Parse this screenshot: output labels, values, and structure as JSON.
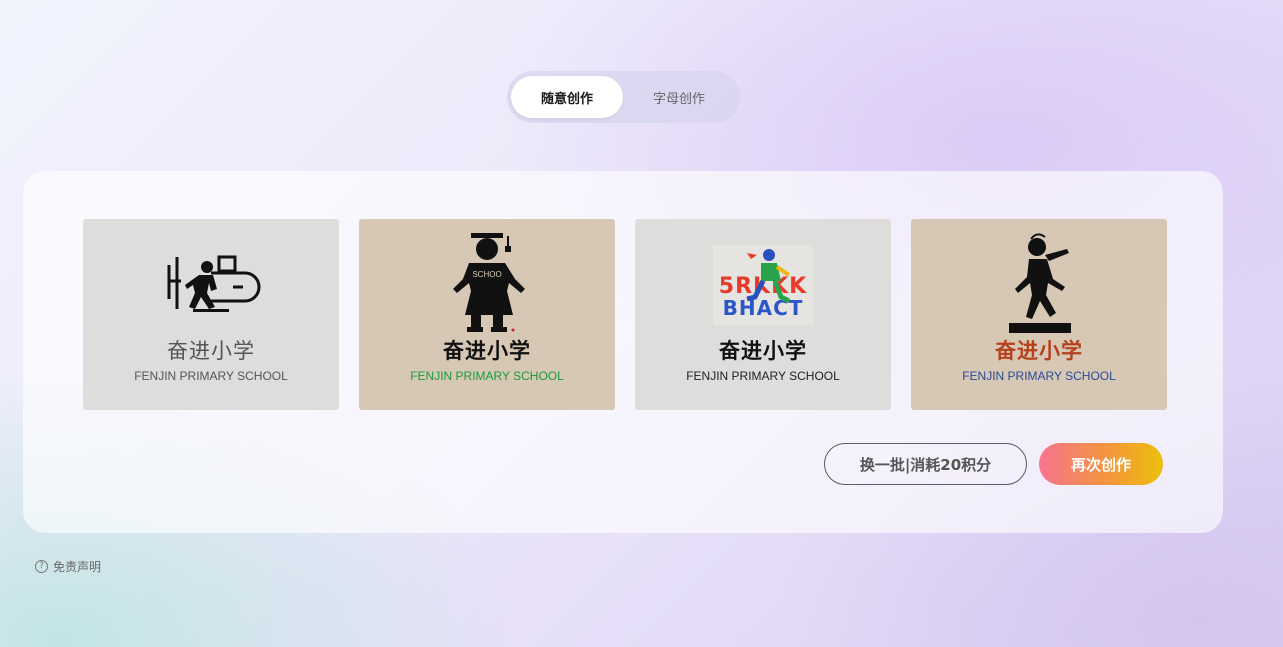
{
  "tabs": [
    {
      "label": "随意创作",
      "active": true
    },
    {
      "label": "字母创作",
      "active": false
    }
  ],
  "cards": [
    {
      "name_cn": "奋进小学",
      "name_en": "FENJIN PRIMARY SCHOOL",
      "bg": "#dedddb",
      "cn_color": "#555555",
      "en_color": "#555555",
      "emblem": "child-with-bus-icon"
    },
    {
      "name_cn": "奋进小学",
      "name_en": "FENJIN PRIMARY SCHOOL",
      "bg": "#d6c8b4",
      "cn_color": "#111111",
      "en_color": "#1a9a3a",
      "emblem": "graduate-child-silhouette-icon"
    },
    {
      "name_cn": "奋进小学",
      "name_en": "FENJIN PRIMARY SCHOOL",
      "bg": "#dedddb",
      "cn_color": "#111111",
      "en_color": "#222222",
      "emblem": "running-child-letters-icon",
      "emblem_text": [
        "5RKKK",
        "BHACT"
      ]
    },
    {
      "name_cn": "奋进小学",
      "name_en": "FENJIN PRIMARY SCHOOL",
      "bg": "#d6c8b4",
      "cn_color": "#b5401e",
      "en_color": "#2a4a94",
      "emblem": "striding-boy-statue-icon"
    }
  ],
  "actions": {
    "refresh_label": "换一批|消耗20积分",
    "create_label": "再次创作"
  },
  "disclaimer": {
    "icon": "question-circle-icon",
    "label": "免责声明"
  }
}
